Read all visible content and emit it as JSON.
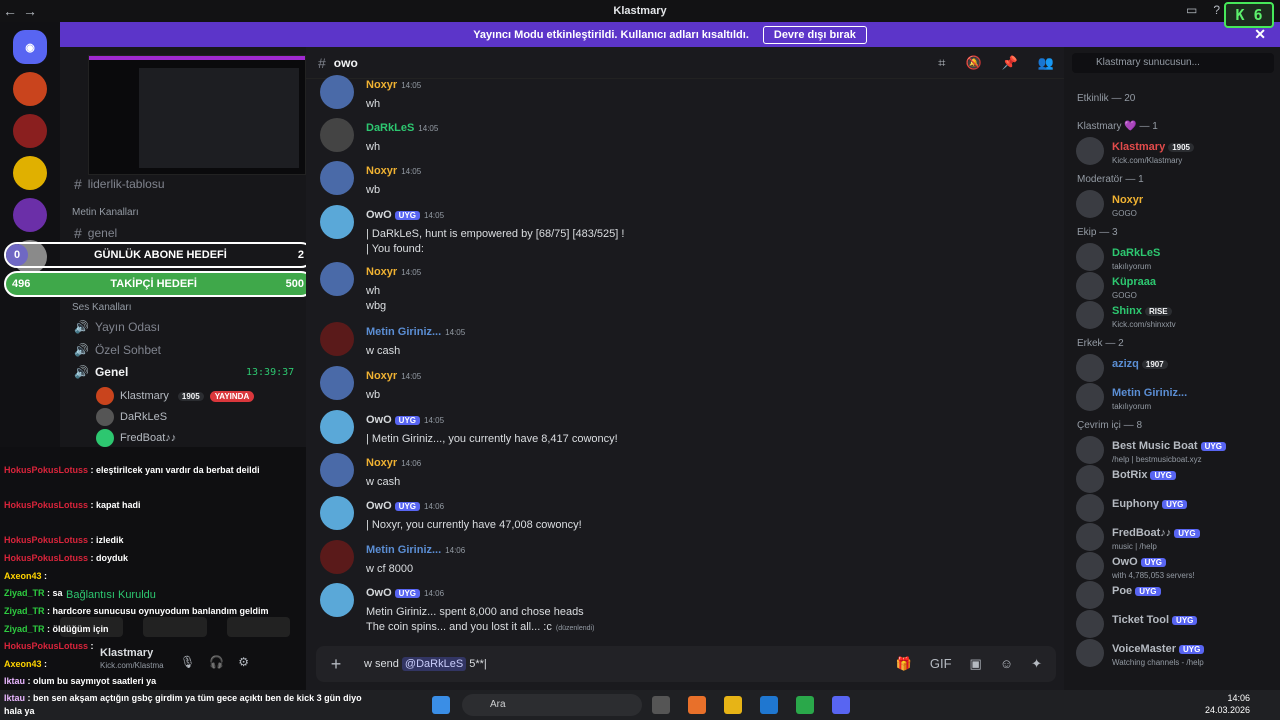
{
  "titlebar": {
    "title": "Klastmary",
    "back": "←",
    "forward": "→"
  },
  "k6": "K 6",
  "banner": {
    "text": "Yayıncı Modu etkinleştirildi. Kullanıcı adları kısaltıldı.",
    "button": "Devre dışı bırak",
    "close": "✕"
  },
  "sidebar": {
    "channel_leaderboard": "liderlik-tablosu",
    "cat_metin": "Metin Kanalları",
    "ch_genel": "genel",
    "cat_ses": "Ses Kanalları",
    "ch_yayin": "Yayın Odası",
    "ch_ozel": "Özel Sohbet",
    "ch_genel_voice": "Genel",
    "voice_time": "13:39:37",
    "vc_users": [
      {
        "name": "Klastmary",
        "badge": "1905",
        "status": "YAYINDA"
      },
      {
        "name": "DaRkLeS"
      },
      {
        "name": "FredBoat♪♪"
      }
    ],
    "conn": "Bağlantısı Kuruldu",
    "footer_user": "Klastmary",
    "footer_status": "Kick.com/Klastma"
  },
  "goals": {
    "abone_label": "GÜNLÜK ABONE HEDEFİ",
    "abone_current": "0",
    "abone_target": "2",
    "takip_label": "TAKİPÇİ HEDEFİ",
    "takip_current": "496",
    "takip_target": "500"
  },
  "chatlog": [
    {
      "user": "HokusPokusLotuss",
      "text": ": eleştirilcek yanı vardır da berbat deildi",
      "cls": "n1"
    },
    {
      "user": "HokusPokusLotuss",
      "text": ": kapat hadi",
      "cls": "n1"
    },
    {
      "user": "HokusPokusLotuss",
      "text": ": izledik",
      "cls": "n1"
    },
    {
      "user": "HokusPokusLotuss",
      "text": ": doyduk",
      "cls": "n1"
    },
    {
      "user": "Axeon43",
      "text": ":",
      "cls": "n3"
    },
    {
      "user": "Ziyad_TR",
      "text": ": sa",
      "cls": "n2"
    },
    {
      "user": "Ziyad_TR",
      "text": ": hardcore sunucusu oynuyodum banlandım geldim",
      "cls": "n2"
    },
    {
      "user": "Ziyad_TR",
      "text": ": öldüğüm için",
      "cls": "n2"
    },
    {
      "user": "HokusPokusLotuss",
      "text": ":",
      "cls": "n1"
    },
    {
      "user": "Axeon43",
      "text": ":",
      "cls": "n3"
    },
    {
      "user": "Iktau",
      "text": ": olum bu saymıyot saatleri ya",
      "cls": "n4"
    }
  ],
  "chatlog_bottom": {
    "user": "Iktau",
    "text": ": ben sen akşam açtığın gsbç girdim ya tüm gece açıktı ben de kick 3 gün diyo hala ya"
  },
  "channel": {
    "name": "owo"
  },
  "messages": [
    {
      "name": "Noxyr",
      "time": "14:05",
      "text": "wh",
      "cls": "c-noxyr"
    },
    {
      "name": "DaRkLeS",
      "time": "14:05",
      "text": "wh",
      "cls": "c-dark"
    },
    {
      "name": "Noxyr",
      "time": "14:05",
      "text": "wb",
      "cls": "c-noxyr"
    },
    {
      "name": "OwO",
      "time": "14:05",
      "tag": "UYG",
      "text": "| DaRkLeS, hunt is empowered by [68/75] [483/525] !",
      "text2": "| You found:",
      "cls": "c-owo"
    },
    {
      "name": "Noxyr",
      "time": "14:05",
      "text": "wh",
      "text2": "wbg",
      "cls": "c-noxyr"
    },
    {
      "name": "Metin Giriniz...",
      "time": "14:05",
      "text": "w cash",
      "cls": "c-metin"
    },
    {
      "name": "Noxyr",
      "time": "14:05",
      "text": "wb",
      "cls": "c-noxyr"
    },
    {
      "name": "OwO",
      "time": "14:05",
      "tag": "UYG",
      "text": "| Metin Giriniz..., you currently have 8,417 cowoncy!",
      "cls": "c-owo"
    },
    {
      "name": "Noxyr",
      "time": "14:06",
      "text": "w cash",
      "cls": "c-noxyr"
    },
    {
      "name": "OwO",
      "time": "14:06",
      "tag": "UYG",
      "text": "| Noxyr, you currently have 47,008 cowoncy!",
      "cls": "c-owo"
    },
    {
      "name": "Metin Giriniz...",
      "time": "14:06",
      "text": "w cf 8000",
      "cls": "c-metin"
    },
    {
      "name": "OwO",
      "time": "14:06",
      "tag": "UYG",
      "text": "Metin Giriniz... spent 8,000 and chose heads",
      "text2": "The coin spins... and you lost it all... :c",
      "edited": "(düzenlendi)",
      "cls": "c-owo"
    }
  ],
  "input": {
    "prefix": "w send ",
    "mention": "@DaRkLeS",
    "suffix": " 5**|"
  },
  "members": {
    "search": "Klastmary sunucusun...",
    "etkinlik": "Etkinlik — 20",
    "groups": [
      {
        "title": "Klastmary 💜 — 1",
        "items": [
          {
            "name": "Klastmary",
            "badge": "1905",
            "sub": "Kick.com/Klastmary",
            "color": "#e24b4b"
          }
        ]
      },
      {
        "title": "Moderatör — 1",
        "items": [
          {
            "name": "Noxyr",
            "sub": "GOGO",
            "color": "#f0b232"
          }
        ]
      },
      {
        "title": "Ekip — 3",
        "items": [
          {
            "name": "DaRkLeS",
            "sub": "takılıyorum",
            "color": "#2dc770"
          },
          {
            "name": "Küpraaa",
            "sub": "GOGO",
            "color": "#2dc770"
          },
          {
            "name": "Shinx",
            "badge": "RISE",
            "sub": "Kick.com/shinxxtv",
            "color": "#2dc770"
          }
        ]
      },
      {
        "title": "Erkek — 2",
        "items": [
          {
            "name": "azizq",
            "badge": "1907",
            "sub": "",
            "color": "#5b8ed4"
          },
          {
            "name": "Metin Giriniz...",
            "sub": "takılıyorum",
            "color": "#5b8ed4"
          }
        ]
      },
      {
        "title": "Çevrim içi — 8",
        "items": [
          {
            "name": "Best Music Boat",
            "tag": "UYG",
            "sub": "/help | bestmusicboat.xyz",
            "color": "#b5bac1"
          },
          {
            "name": "BotRix",
            "tag": "UYG",
            "sub": "",
            "color": "#b5bac1"
          },
          {
            "name": "Euphony",
            "tag": "UYG",
            "sub": "",
            "color": "#b5bac1"
          },
          {
            "name": "FredBoat♪♪",
            "tag": "UYG",
            "sub": "music | /help",
            "color": "#b5bac1"
          },
          {
            "name": "OwO",
            "tag": "UYG",
            "sub": "with 4,785,053 servers!",
            "color": "#b5bac1"
          },
          {
            "name": "Poe",
            "tag": "UYG",
            "sub": "",
            "color": "#b5bac1"
          },
          {
            "name": "Ticket Tool",
            "tag": "UYG",
            "sub": "",
            "color": "#b5bac1"
          },
          {
            "name": "VoiceMaster",
            "tag": "UYG",
            "sub": "Watching channels - /help",
            "color": "#b5bac1"
          }
        ]
      }
    ]
  },
  "taskbar": {
    "search": "Ara",
    "time": "14:06",
    "date": "24.03.2026"
  }
}
